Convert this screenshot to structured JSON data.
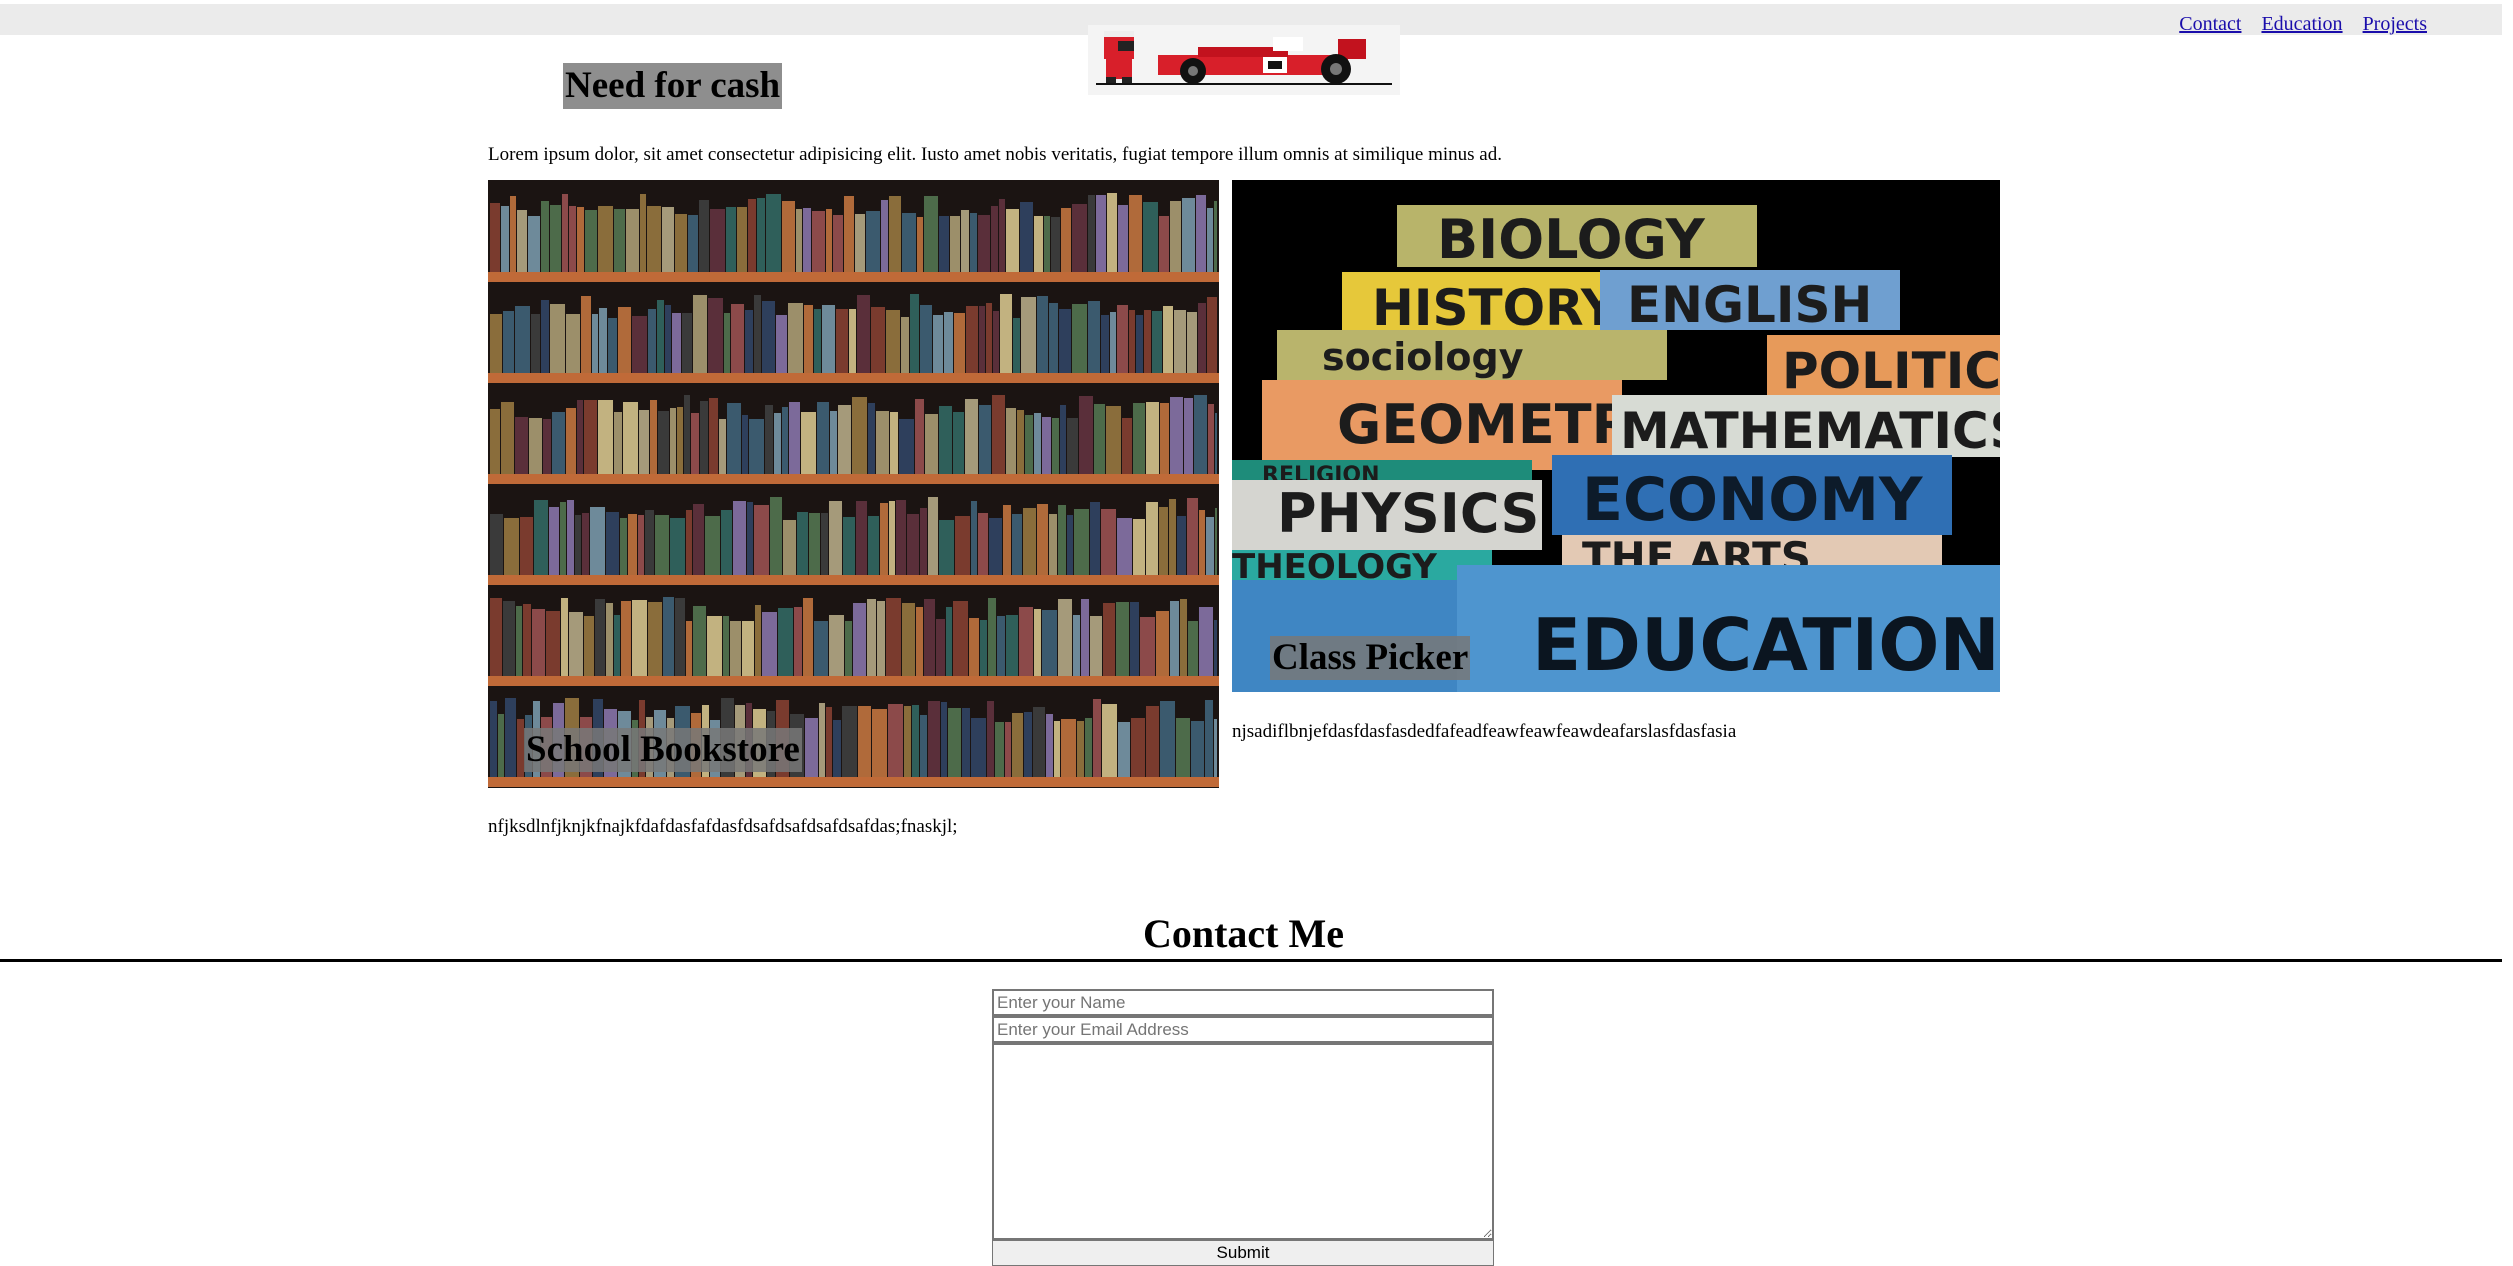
{
  "nav": {
    "links": [
      {
        "label": "Contact"
      },
      {
        "label": "Education"
      },
      {
        "label": "Projects"
      }
    ]
  },
  "header": {
    "title": "Need for cash",
    "logo_icon": "race-car-logo"
  },
  "intro": {
    "text": "Lorem ipsum dolor, sit amet consectetur adipisicing elit. Iusto amet nobis veritatis, fugiat tempore illum omnis at similique minus ad."
  },
  "cards": [
    {
      "caption": "School Bookstore",
      "description": "nfjksdlnfjknjkfnajkfdafdasfafdasfdsafdsafdsafdsafdas;fnaskjl;"
    },
    {
      "caption": "Class Picker",
      "description": "njsadiflbnjefdasfdasfasdedfafeadfeawfeawfeawdeafarslasfdasfasia",
      "book_spines": [
        "BIOLOGY",
        "HISTORY",
        "ENGLISH",
        "sociology",
        "POLITIC",
        "GEOMETR",
        "MATHEMATICS",
        "RELIGION",
        "PHYSICS",
        "ECONOMY",
        "THEOLOGY",
        "THE ARTS",
        "EDUCATION"
      ]
    }
  ],
  "contact": {
    "title": "Contact Me",
    "name_placeholder": "Enter your Name",
    "email_placeholder": "Enter your Email Address",
    "message_value": "",
    "submit_label": "Submit"
  }
}
